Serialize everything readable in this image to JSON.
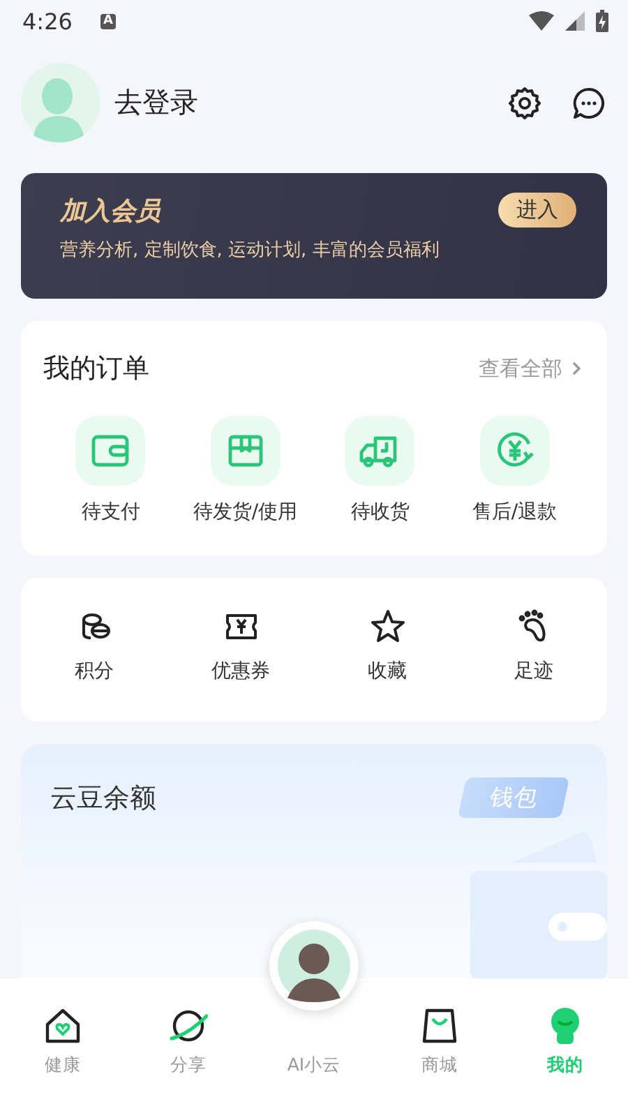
{
  "status_bar": {
    "time": "4:26",
    "notification_badge": "A"
  },
  "profile": {
    "login_label": "去登录"
  },
  "membership": {
    "title": "加入会员",
    "button": "进入",
    "description": "营养分析, 定制饮食, 运动计划, 丰富的会员福利"
  },
  "orders": {
    "title": "我的订单",
    "view_all": "查看全部",
    "items": [
      {
        "label": "待支付"
      },
      {
        "label": "待发货/使用"
      },
      {
        "label": "待收货"
      },
      {
        "label": "售后/退款"
      }
    ]
  },
  "shortcuts": [
    {
      "label": "积分"
    },
    {
      "label": "优惠券"
    },
    {
      "label": "收藏"
    },
    {
      "label": "足迹"
    }
  ],
  "wallet": {
    "title": "云豆余额",
    "button": "钱包"
  },
  "bottom_nav": [
    {
      "label": "健康",
      "selected": false
    },
    {
      "label": "分享",
      "selected": false
    },
    {
      "label": "AI小云",
      "selected": false
    },
    {
      "label": "商城",
      "selected": false
    },
    {
      "label": "我的",
      "selected": true
    }
  ]
}
